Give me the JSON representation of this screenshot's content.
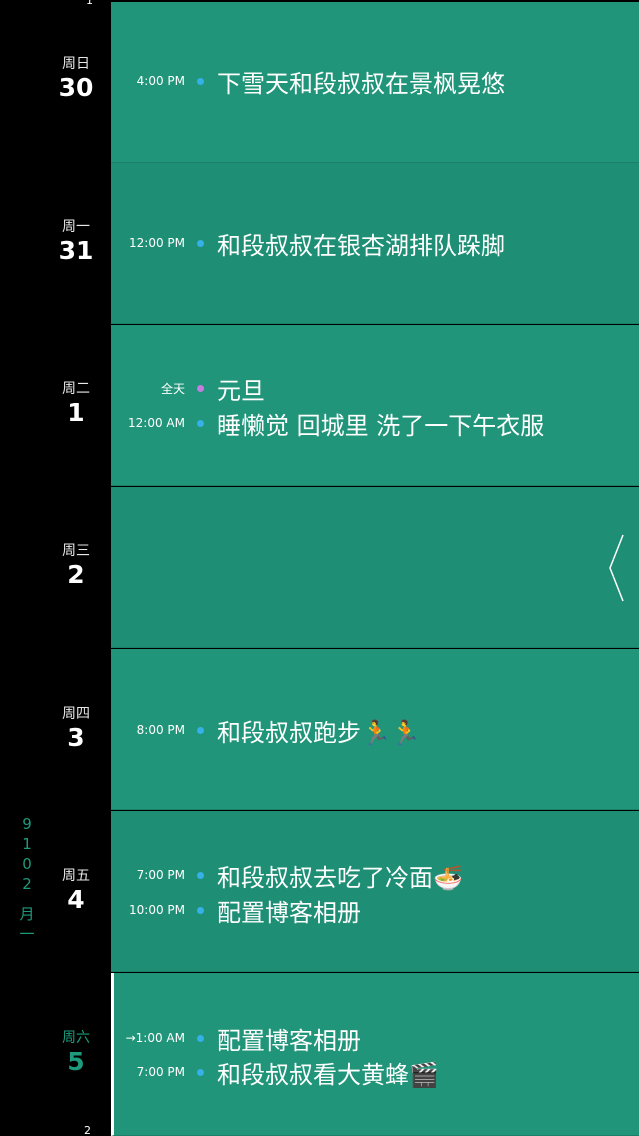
{
  "colors": {
    "rail_bg": "#000000",
    "row_bg": "#1e8f75",
    "row_alt_bg": "#209579",
    "accent": "#1e9a7c",
    "dot_blue": "#35b0e8",
    "dot_purple": "#c77de0"
  },
  "rail": {
    "top_tick": "1",
    "bottom_tick": "2",
    "month_vertical": [
      "一",
      "月"
    ],
    "year_vertical": [
      "2",
      "0",
      "1",
      "9"
    ]
  },
  "days": [
    {
      "dow": "周日",
      "num": "30",
      "events": [
        {
          "time": "4:00 PM",
          "dot": "blue",
          "title": "下雪天和段叔叔在景枫晃悠"
        }
      ]
    },
    {
      "dow": "周一",
      "num": "31",
      "events": [
        {
          "time": "12:00 PM",
          "dot": "blue",
          "title": "和段叔叔在银杏湖排队跺脚"
        }
      ]
    },
    {
      "dow": "周二",
      "num": "1",
      "events": [
        {
          "time": "全天",
          "dot": "purple",
          "title": "元旦"
        },
        {
          "time": "12:00 AM",
          "dot": "blue",
          "title": "睡懒觉 回城里 洗了一下午衣服"
        }
      ]
    },
    {
      "dow": "周三",
      "num": "2",
      "events": []
    },
    {
      "dow": "周四",
      "num": "3",
      "events": [
        {
          "time": "8:00 PM",
          "dot": "blue",
          "title": "和段叔叔跑步🏃🏃"
        }
      ]
    },
    {
      "dow": "周五",
      "num": "4",
      "events": [
        {
          "time": "7:00 PM",
          "dot": "blue",
          "title": "和段叔叔去吃了冷面🍜"
        },
        {
          "time": "10:00 PM",
          "dot": "blue",
          "title": "配置博客相册"
        }
      ]
    },
    {
      "dow": "周六",
      "num": "5",
      "active": true,
      "events": [
        {
          "time": "→1:00 AM",
          "dot": "blue",
          "title": "配置博客相册"
        },
        {
          "time": "7:00 PM",
          "dot": "blue",
          "title": "和段叔叔看大黄蜂🎬"
        }
      ]
    }
  ],
  "back_arrow_icon": "chevron-left-icon"
}
